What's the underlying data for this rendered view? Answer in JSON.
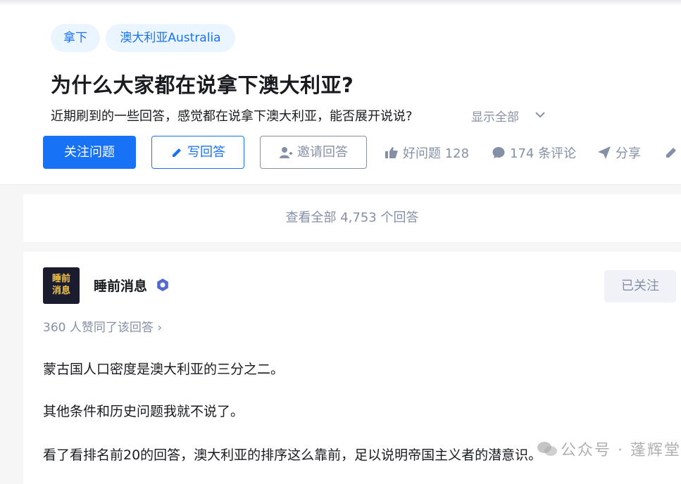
{
  "tags": [
    "拿下",
    "澳大利亚Australia"
  ],
  "question": {
    "title": "为什么大家都在说拿下澳大利亚?",
    "detail": "近期刷到的一些回答，感觉都在说拿下澳大利亚，能否展开说说?",
    "show_all": "显示全部"
  },
  "actions": {
    "follow": "关注问题",
    "write": "写回答",
    "invite": "邀请回答",
    "good_question": "好问题 128",
    "comments": "174 条评论",
    "share": "分享"
  },
  "view_all": "查看全部 4,753 个回答",
  "answer": {
    "author": "睡前消息",
    "avatar_text": "睡前消息",
    "followed_label": "已关注",
    "votes": "360 人赞同了该回答 ›",
    "paragraphs": [
      "蒙古国人口密度是澳大利亚的三分之二。",
      "其他条件和历史问题我就不说了。",
      "看了看排名前20的回答，澳大利亚的排序这么靠前，足以说明帝国主义者的潜意识。"
    ]
  },
  "watermark": "公众号 · 蓬辉堂",
  "colors": {
    "accent": "#1772f6",
    "muted": "#8590a6",
    "text": "#191b1f"
  }
}
